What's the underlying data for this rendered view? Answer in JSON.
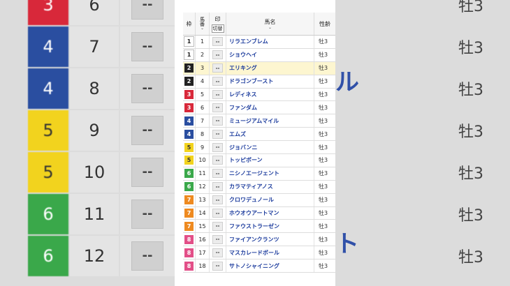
{
  "header": {
    "waku": "枠",
    "umaban": "馬番",
    "mark": "印",
    "mark_button": "切替",
    "horse_name": "馬名",
    "sex_age": "性齢",
    "sort_chevron": "⌄"
  },
  "mark_placeholder": "--",
  "waku_colors": {
    "1": {
      "bg": "#ffffff",
      "fg": "#222222"
    },
    "2": {
      "bg": "#222222",
      "fg": "#ffffff"
    },
    "3": {
      "bg": "#d8283a",
      "fg": "#ffffff"
    },
    "4": {
      "bg": "#2a4ea0",
      "fg": "#ffffff"
    },
    "5": {
      "bg": "#f2d31e",
      "fg": "#333333"
    },
    "6": {
      "bg": "#3aa84a",
      "fg": "#ffffff"
    },
    "7": {
      "bg": "#ee8a20",
      "fg": "#ffffff"
    },
    "8": {
      "bg": "#e24f88",
      "fg": "#ffffff"
    }
  },
  "rows": [
    {
      "waku": "1",
      "umaban": "1",
      "name": "リラエンブレム",
      "sex": "牡3"
    },
    {
      "waku": "1",
      "umaban": "2",
      "name": "ショウヘイ",
      "sex": "牡3"
    },
    {
      "waku": "2",
      "umaban": "3",
      "name": "エリキング",
      "sex": "牡3",
      "selected": true
    },
    {
      "waku": "2",
      "umaban": "4",
      "name": "ドラゴンブースト",
      "sex": "牡3"
    },
    {
      "waku": "3",
      "umaban": "5",
      "name": "レディネス",
      "sex": "牡3"
    },
    {
      "waku": "3",
      "umaban": "6",
      "name": "ファンダム",
      "sex": "牡3"
    },
    {
      "waku": "4",
      "umaban": "7",
      "name": "ミュージアムマイル",
      "sex": "牡3"
    },
    {
      "waku": "4",
      "umaban": "8",
      "name": "エムズ",
      "sex": "牡3"
    },
    {
      "waku": "5",
      "umaban": "9",
      "name": "ジョバンニ",
      "sex": "牡3"
    },
    {
      "waku": "5",
      "umaban": "10",
      "name": "トッピボーン",
      "sex": "牡3"
    },
    {
      "waku": "6",
      "umaban": "11",
      "name": "ニシノエージェント",
      "sex": "牡3"
    },
    {
      "waku": "6",
      "umaban": "12",
      "name": "カラマティアノス",
      "sex": "牡3"
    },
    {
      "waku": "7",
      "umaban": "13",
      "name": "クロワデュノール",
      "sex": "牡3"
    },
    {
      "waku": "7",
      "umaban": "14",
      "name": "ホウオウアートマン",
      "sex": "牡3"
    },
    {
      "waku": "7",
      "umaban": "15",
      "name": "ファウストラーゼン",
      "sex": "牡3"
    },
    {
      "waku": "8",
      "umaban": "16",
      "name": "ファイアンクランツ",
      "sex": "牡3"
    },
    {
      "waku": "8",
      "umaban": "17",
      "name": "マスカレードボール",
      "sex": "牡3"
    },
    {
      "waku": "8",
      "umaban": "18",
      "name": "サトノシャイニング",
      "sex": "牡3"
    }
  ],
  "background_left": [
    {
      "waku": "3",
      "umaban": "6"
    },
    {
      "waku": "4",
      "umaban": "7"
    },
    {
      "waku": "4",
      "umaban": "8"
    },
    {
      "waku": "5",
      "umaban": "9"
    },
    {
      "waku": "5",
      "umaban": "10"
    },
    {
      "waku": "6",
      "umaban": "11"
    },
    {
      "waku": "6",
      "umaban": "12"
    }
  ],
  "background_right": {
    "sex_labels": [
      "牡3",
      "牡3",
      "牡3",
      "牡3",
      "牡3",
      "牡3",
      "牡3"
    ],
    "glyphs": [
      "ル",
      "ト"
    ]
  }
}
